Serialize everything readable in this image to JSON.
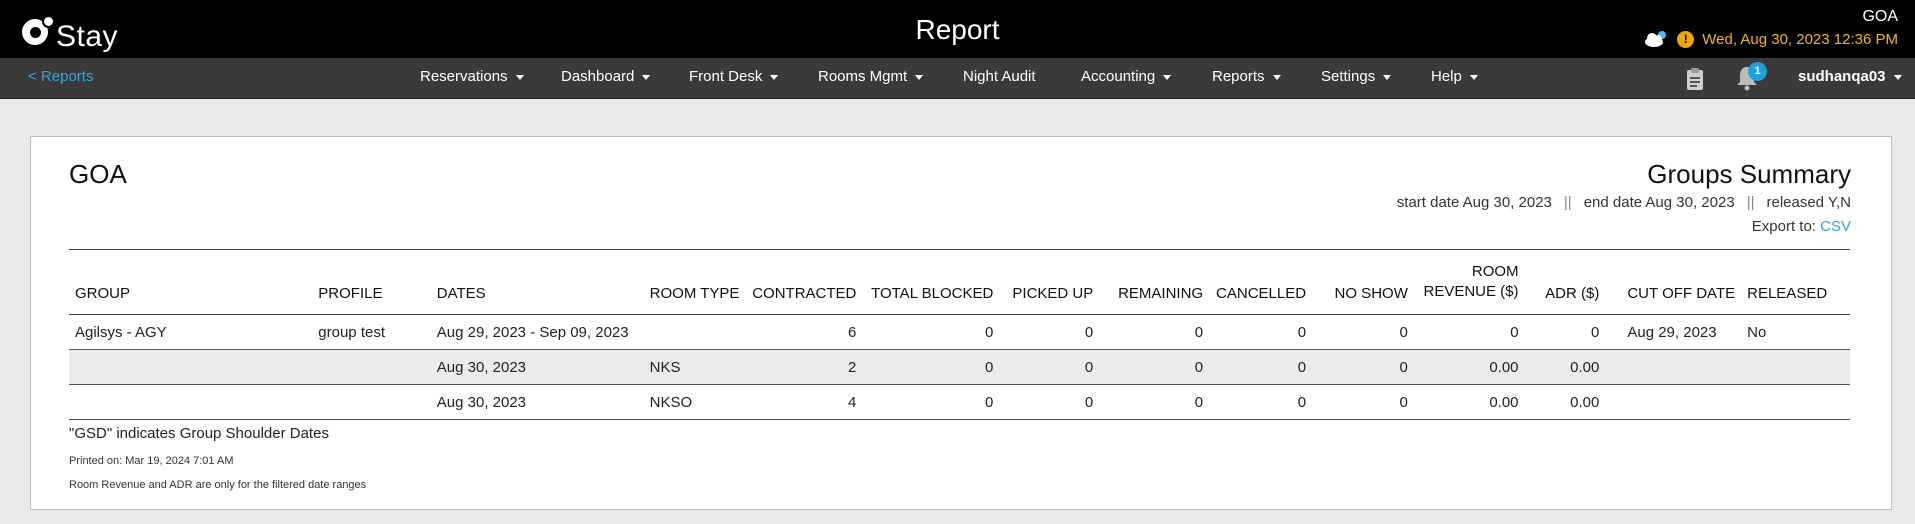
{
  "app": {
    "logo_text": "Stay",
    "title": "Report",
    "property": "GOA",
    "datetime": "Wed, Aug 30, 2023 12:36 PM",
    "alert_symbol": "!"
  },
  "nav": {
    "back_label": "< Reports",
    "items": [
      "Reservations",
      "Dashboard",
      "Front Desk",
      "Rooms Mgmt",
      "Night Audit",
      "Accounting",
      "Reports",
      "Settings",
      "Help"
    ],
    "notification_count": "1",
    "user": "sudhanqa03"
  },
  "report": {
    "property": "GOA",
    "title": "Groups Summary",
    "start_date": "start date Aug 30, 2023",
    "separator": "||",
    "end_date": "end date Aug 30, 2023",
    "released": "released Y,N",
    "export_label": "Export to:",
    "export_link": "CSV",
    "columns": [
      "GROUP",
      "PROFILE",
      "DATES",
      "ROOM TYPE",
      "CONTRACTED",
      "TOTAL BLOCKED",
      "PICKED UP",
      "REMAINING",
      "CANCELLED",
      "NO SHOW",
      "ROOM REVENUE ($)",
      "ADR ($)",
      "CUT OFF DATE",
      "RELEASED"
    ],
    "rows": [
      [
        "Agilsys - AGY",
        "group test",
        "Aug 29, 2023 - Sep 09, 2023",
        "",
        "6",
        "0",
        "0",
        "0",
        "0",
        "0",
        "0",
        "0",
        "Aug 29, 2023",
        "No"
      ],
      [
        "",
        "",
        "Aug 30, 2023",
        "NKS",
        "2",
        "0",
        "0",
        "0",
        "0",
        "0",
        "0.00",
        "0.00",
        "",
        ""
      ],
      [
        "",
        "",
        "Aug 30, 2023",
        "NKSO",
        "4",
        "0",
        "0",
        "0",
        "0",
        "0",
        "0.00",
        "0.00",
        "",
        ""
      ]
    ],
    "note_gsd": "\"GSD\" indicates Group Shoulder Dates",
    "printed_on": "Printed on: Mar 19, 2024 7:01 AM",
    "note_revenue": "Room Revenue and ADR are only for the filtered date ranges"
  },
  "colors": {
    "topbar": "#000000",
    "navbar": "#3a3a3a",
    "link": "#37a3db",
    "datetime": "#f5b800",
    "badge": "#1da1d8"
  }
}
